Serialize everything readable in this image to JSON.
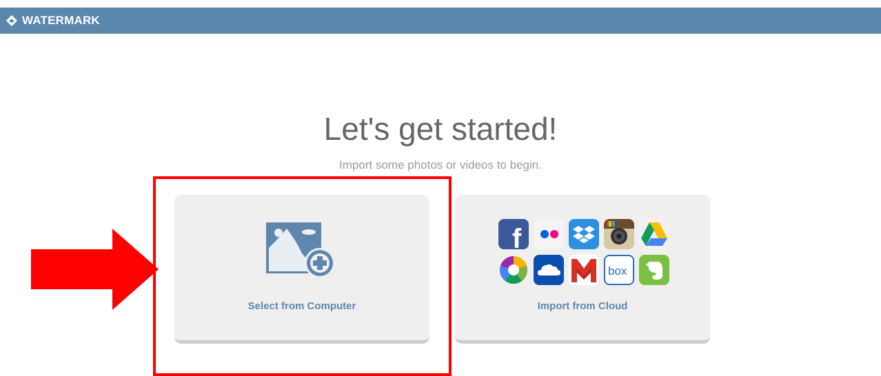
{
  "app": {
    "title": "WATERMARK",
    "logo_icon": "watermark-logo-icon",
    "bar_color": "#5b87ad"
  },
  "main": {
    "heading": "Let's get started!",
    "subheading": "Import some photos or videos to begin."
  },
  "options": {
    "computer": {
      "label": "Select from Computer",
      "icon": "image-add-icon"
    },
    "cloud": {
      "label": "Import from Cloud",
      "services": [
        "facebook",
        "flickr",
        "dropbox",
        "instagram",
        "google-drive",
        "picasa",
        "onedrive",
        "gmail",
        "box",
        "evernote"
      ]
    }
  },
  "annotations": {
    "highlight_color": "#ff0000",
    "arrow_icon": "red-arrow-icon"
  },
  "colors": {
    "accent": "#5f87ae",
    "card_bg": "#efefef"
  }
}
